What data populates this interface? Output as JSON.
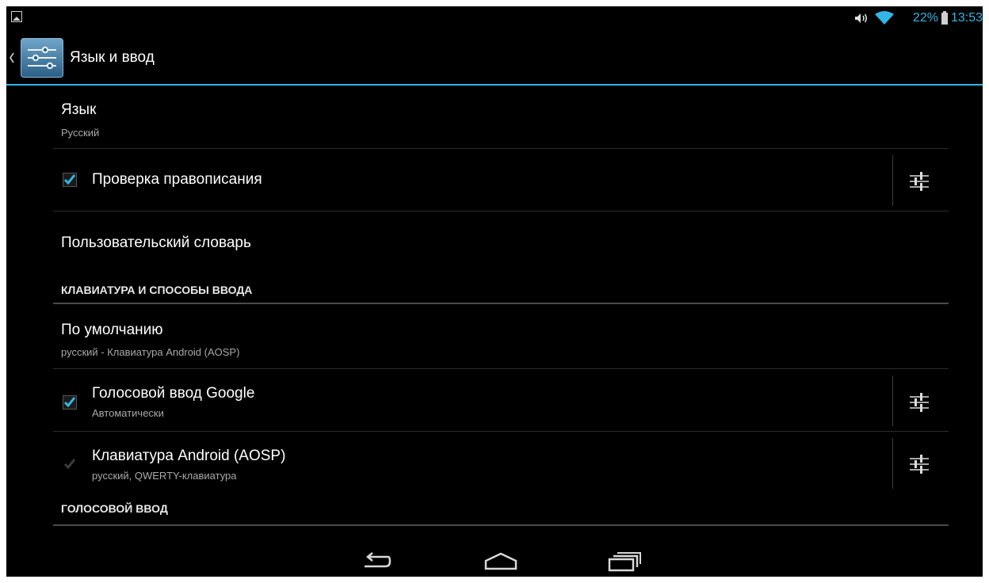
{
  "status_bar": {
    "battery_percent": "22%",
    "time": "13:53",
    "icons": [
      "gallery-notification-icon",
      "volume-icon",
      "wifi-icon",
      "battery-icon"
    ],
    "accent_color": "#33b5e5"
  },
  "action_bar": {
    "title": "Язык и ввод",
    "icons": [
      "up-caret-icon",
      "settings-app-icon"
    ]
  },
  "preferences": {
    "language": {
      "title": "Язык",
      "summary": "Русский"
    },
    "spell_check": {
      "title": "Проверка правописания",
      "checked": true
    },
    "user_dictionary": {
      "title": "Пользовательский словарь"
    },
    "keyboard_header": "КЛАВИАТУРА И СПОСОБЫ ВВОДА",
    "default_input": {
      "title": "По умолчанию",
      "summary": "русский - Клавиатура Android (AOSP)"
    },
    "google_voice": {
      "title": "Голосовой ввод Google",
      "summary": "Автоматически",
      "checked": true
    },
    "aosp_keyboard": {
      "title": "Клавиатура Android (AOSP)",
      "summary": "русский, QWERTY-клавиатура",
      "checked": true,
      "enabled": false
    },
    "voice_header": "ГОЛОСОВОЙ ВВОД"
  },
  "nav_bar": {
    "icons": [
      "back-icon",
      "home-icon",
      "recent-apps-icon"
    ]
  }
}
